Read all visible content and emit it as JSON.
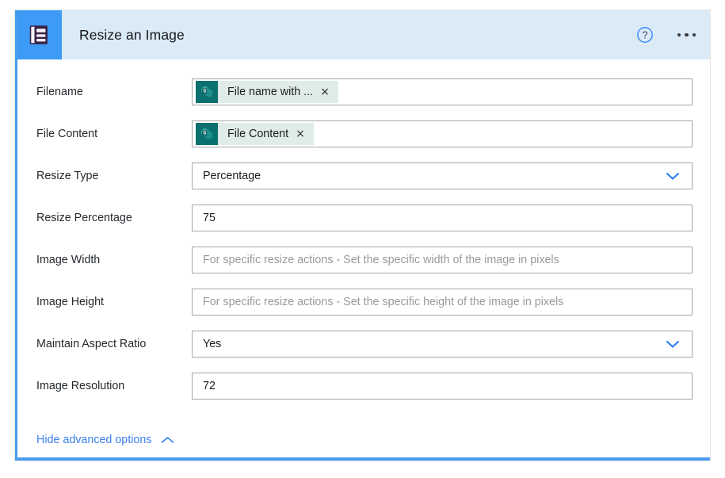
{
  "header": {
    "title": "Resize an Image",
    "app_icon": "image-document-icon",
    "help_icon": "help-circle-icon",
    "more_icon": "ellipsis-icon",
    "tile_color": "#3d9bf5",
    "bar_color": "#dbeaf7",
    "accent_color": "#4a9cf0"
  },
  "form": {
    "fields": [
      {
        "label": "Filename",
        "type": "token",
        "token": {
          "icon": "sharepoint-icon",
          "label": "File name with ...",
          "close": "×"
        }
      },
      {
        "label": "File Content",
        "type": "token",
        "token": {
          "icon": "sharepoint-icon",
          "label": "File Content",
          "close": "×"
        }
      },
      {
        "label": "Resize Type",
        "type": "dropdown",
        "value": "Percentage",
        "chevron": "chevron-down-icon"
      },
      {
        "label": "Resize Percentage",
        "type": "text",
        "value": "75"
      },
      {
        "label": "Image Width",
        "type": "text",
        "value": "",
        "placeholder": "For specific resize actions - Set the specific width of the image in pixels"
      },
      {
        "label": "Image Height",
        "type": "text",
        "value": "",
        "placeholder": "For specific resize actions - Set the specific height of the image in pixels"
      },
      {
        "label": "Maintain Aspect Ratio",
        "type": "dropdown",
        "value": "Yes",
        "chevron": "chevron-down-icon"
      },
      {
        "label": "Image Resolution",
        "type": "text",
        "value": "72"
      }
    ]
  },
  "footer": {
    "advanced_label": "Hide advanced options",
    "advanced_icon": "chevron-up-icon",
    "link_color": "#3b82ec"
  }
}
